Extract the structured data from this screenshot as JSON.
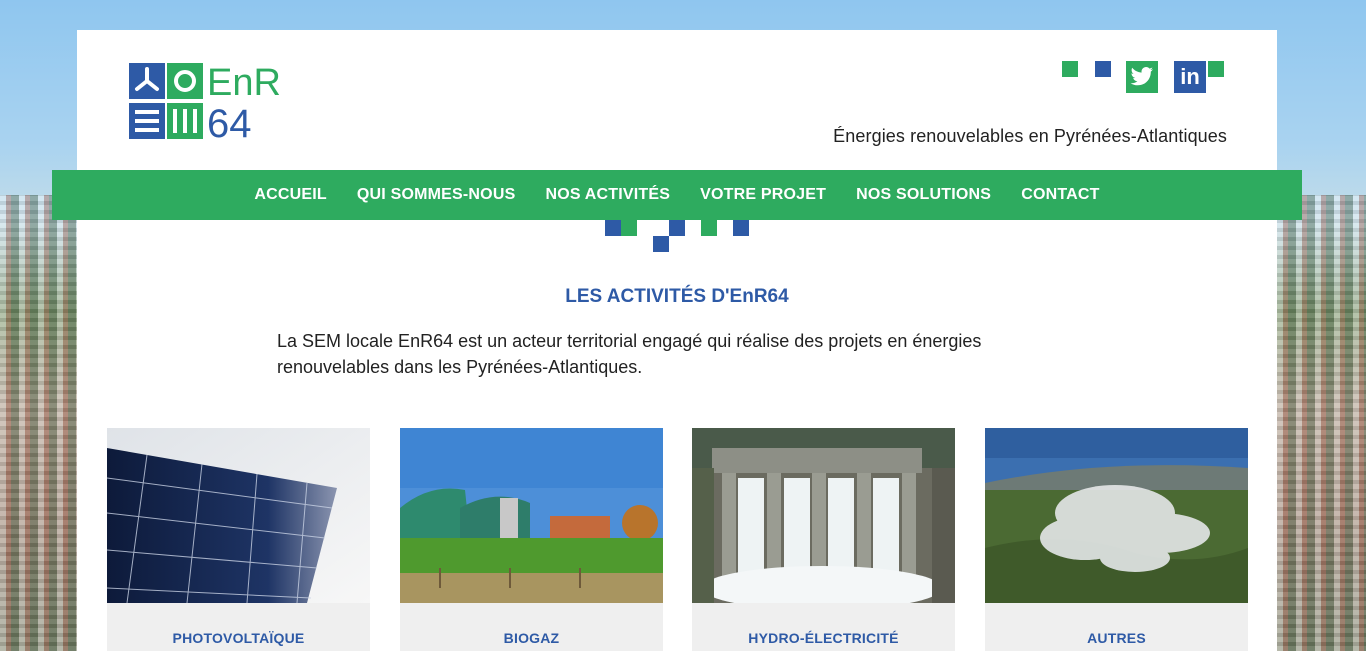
{
  "site": {
    "tagline": "Énergies renouvelables en Pyrénées-Atlantiques",
    "brand_colors": {
      "green": "#2eab5f",
      "blue": "#2e5aa6"
    }
  },
  "logo": {
    "text_line1": "EnR",
    "text_line2": "64"
  },
  "social": {
    "twitter_icon": "twitter-icon",
    "linkedin_label": "in"
  },
  "nav": {
    "items": [
      "ACCUEIL",
      "QUI SOMMES-NOUS",
      "NOS ACTIVITÉS",
      "VOTRE PROJET",
      "NOS SOLUTIONS",
      "CONTACT"
    ]
  },
  "section": {
    "title": "LES ACTIVITÉS D'EnR64",
    "intro": "La SEM locale EnR64 est un acteur territorial engagé qui réalise des projets en énergies renouvelables dans les Pyrénées-Atlantiques."
  },
  "cards": [
    {
      "label": "PHOTOVOLTAÏQUE",
      "image": "solar-panel-image"
    },
    {
      "label": "BIOGAZ",
      "image": "biogas-plant-image"
    },
    {
      "label": "HYDRO-ÉLECTRICITÉ",
      "image": "dam-image"
    },
    {
      "label": "AUTRES",
      "image": "geothermal-steam-image"
    }
  ]
}
